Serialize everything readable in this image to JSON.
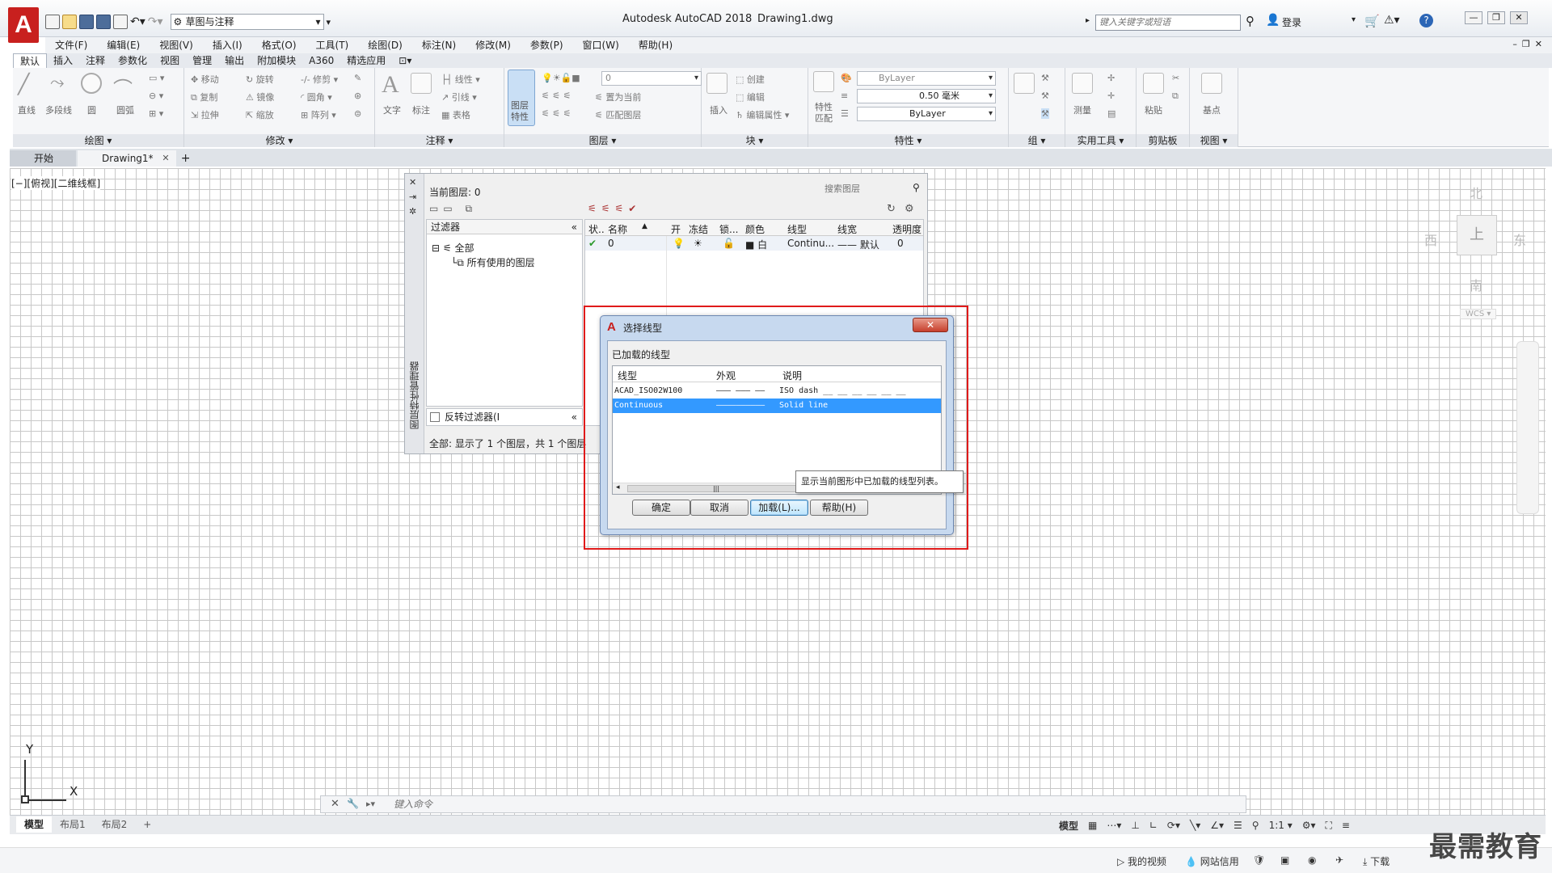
{
  "title_bar": {
    "app_title": "Autodesk AutoCAD 2018",
    "file_name": "Drawing1.dwg",
    "workspace": "草图与注释",
    "search_placeholder": "键入关键字或短语",
    "login_label": "登录"
  },
  "menu": [
    "文件(F)",
    "编辑(E)",
    "视图(V)",
    "插入(I)",
    "格式(O)",
    "工具(T)",
    "绘图(D)",
    "标注(N)",
    "修改(M)",
    "参数(P)",
    "窗口(W)",
    "帮助(H)"
  ],
  "ribbon_tabs": [
    "默认",
    "插入",
    "注释",
    "参数化",
    "视图",
    "管理",
    "输出",
    "附加模块",
    "A360",
    "精选应用"
  ],
  "ribbon": {
    "draw": {
      "title": "绘图 ▾",
      "line": "直线",
      "polyline": "多段线",
      "circle": "圆",
      "arc": "圆弧"
    },
    "modify": {
      "title": "修改 ▾",
      "move": "移动",
      "rotate": "旋转",
      "trim": "修剪",
      "copy": "复制",
      "mirror": "镜像",
      "fillet": "圆角",
      "stretch": "拉伸",
      "scale": "缩放",
      "array": "阵列"
    },
    "annotation": {
      "title": "注释 ▾",
      "text": "文字",
      "dimension": "标注",
      "linear": "线性",
      "leader": "引线",
      "table": "表格"
    },
    "layers": {
      "title": "图层 ▾",
      "props": "图层\n特性",
      "current_layer": "0",
      "set_current": "置为当前",
      "match": "匹配图层"
    },
    "block": {
      "title": "块 ▾",
      "insert": "插入",
      "create": "创建",
      "edit": "编辑",
      "edit_attr": "编辑属性"
    },
    "properties": {
      "title": "特性 ▾",
      "match": "特性\n匹配",
      "color": "ByLayer",
      "lineweight": "0.50 毫米",
      "linetype": "ByLayer"
    },
    "groups": {
      "title": "组 ▾"
    },
    "utilities": {
      "title": "实用工具 ▾",
      "measure": "测量"
    },
    "clipboard": {
      "title": "剪贴板",
      "paste": "粘贴"
    },
    "view": {
      "title": "视图 ▾",
      "base": "基点"
    }
  },
  "doc_tabs": [
    {
      "label": "开始"
    },
    {
      "label": "Drawing1*"
    }
  ],
  "viewport_label": "[−][俯视][二维线框]",
  "view_cube": {
    "north": "北",
    "south": "南",
    "east": "东",
    "west": "西",
    "wcs": "WCS ▾",
    "face": "上"
  },
  "ucs": {
    "x": "X",
    "y": "Y"
  },
  "layer_palette": {
    "side_title": "图层特性管理器",
    "current_layer": "当前图层: 0",
    "search_placeholder": "搜索图层",
    "filter_header": "过滤器",
    "tree_all": "全部",
    "tree_used": "所有使用的图层",
    "invert_filter": "反转过滤器(I",
    "status": "全部: 显示了 1 个图层，共 1 个图层",
    "columns": [
      "状..",
      "名称",
      "开",
      "冻结",
      "锁...",
      "颜色",
      "线型",
      "线宽",
      "透明度"
    ],
    "row": {
      "name": "0",
      "color": "■ 白",
      "linetype": "Continu...",
      "lineweight": "—— 默认",
      "transparency": "0"
    }
  },
  "linetype_dialog": {
    "title": "选择线型",
    "close": "✕",
    "section": "已加载的线型",
    "columns": [
      "线型",
      "外观",
      "说明"
    ],
    "rows": [
      {
        "name": "ACAD_ISO02W100",
        "appearance": "——— ——— ——",
        "description": "ISO dash __ __ __ __ __ __"
      },
      {
        "name": "Continuous",
        "appearance": "——————————",
        "description": "Solid line"
      }
    ],
    "tooltip": "显示当前图形中已加载的线型列表。",
    "buttons": {
      "ok": "确定",
      "cancel": "取消",
      "load": "加载(L)...",
      "help": "帮助(H)"
    }
  },
  "command_line": {
    "placeholder": "键入命令"
  },
  "layout_tabs": [
    "模型",
    "布局1",
    "布局2"
  ],
  "status_bar": {
    "model": "模型",
    "scale": "1:1 ▾"
  },
  "bottom_bar": {
    "video": "我的视频",
    "credit": "网站信用",
    "download": "下载"
  },
  "watermark": "最需教育"
}
